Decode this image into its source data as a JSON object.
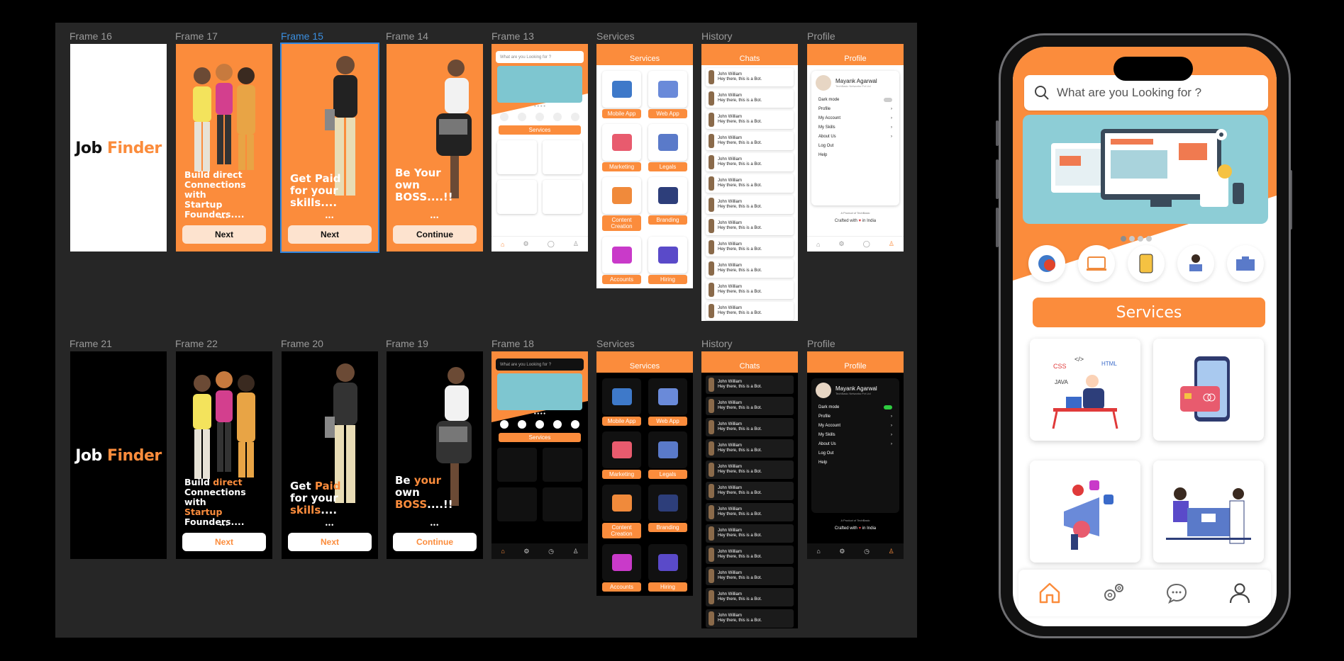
{
  "frame_labels": {
    "f16": "Frame 16",
    "f17": "Frame 17",
    "f15": "Frame 15",
    "f14": "Frame 14",
    "f13": "Frame 13",
    "services": "Services",
    "history": "History",
    "profile": "Profile",
    "f21": "Frame 21",
    "f22": "Frame 22",
    "f20": "Frame 20",
    "f19": "Frame 19",
    "f18": "Frame 18",
    "services2": "Services",
    "history2": "History",
    "profile2": "Profile"
  },
  "logo": {
    "job": "Job",
    "finder": "Finder"
  },
  "onboarding": {
    "build_1": "Build direct",
    "build_2": "Connections with",
    "build_3": "Startup",
    "build_4": "Founders....",
    "build_hl_a": "direct",
    "build_hl_b": "Startup",
    "paid_1": "Get Paid",
    "paid_2": "for your",
    "paid_3": "skills....",
    "boss_1": "Be Your",
    "boss_2": "own",
    "boss_3": "BOSS....!!",
    "dark_paid_get": "Get",
    "dark_paid_hl": "Paid",
    "dark_paid_2": "for your",
    "dark_paid_3": "skills",
    "dark_boss_be": "Be",
    "dark_boss_hl": "your",
    "dark_boss_own": "own",
    "dark_boss_boss": "BOSS",
    "dark_boss_tail": "....!!",
    "dots": "•••",
    "next": "Next",
    "continue": "Continue"
  },
  "mini": {
    "search_placeholder": "What are you Looking for ?",
    "services_btn": "Services",
    "services_title": "Services",
    "chats_title": "Chats",
    "profile_title": "Profile",
    "chat_name": "John William",
    "chat_msg": "Hey there, this is a Bot.",
    "services": [
      "Mobile App",
      "Web App",
      "Marketing",
      "Legals",
      "Content Creation",
      "Branding",
      "Accounts",
      "Hiring"
    ],
    "profile_name": "Mayank Agarwal",
    "profile_company": "TechBasic Networks Pvt Ltd",
    "dark_mode": "Dark mode",
    "profile_menu": [
      "Profile",
      "My Account",
      "My Skills",
      "About Us",
      "Log Out",
      "Help"
    ],
    "product_of": "A Product of TechBasic",
    "crafted": "Crafted with",
    "in_india": "in India"
  },
  "phone": {
    "search_placeholder": "What are you Looking for ?",
    "services_btn": "Services",
    "nav": [
      "home-icon",
      "settings-icon",
      "chat-icon",
      "user-icon"
    ]
  },
  "colors": {
    "accent": "#fb8c3c",
    "canvas": "#262626",
    "selection": "#2f86e0"
  }
}
